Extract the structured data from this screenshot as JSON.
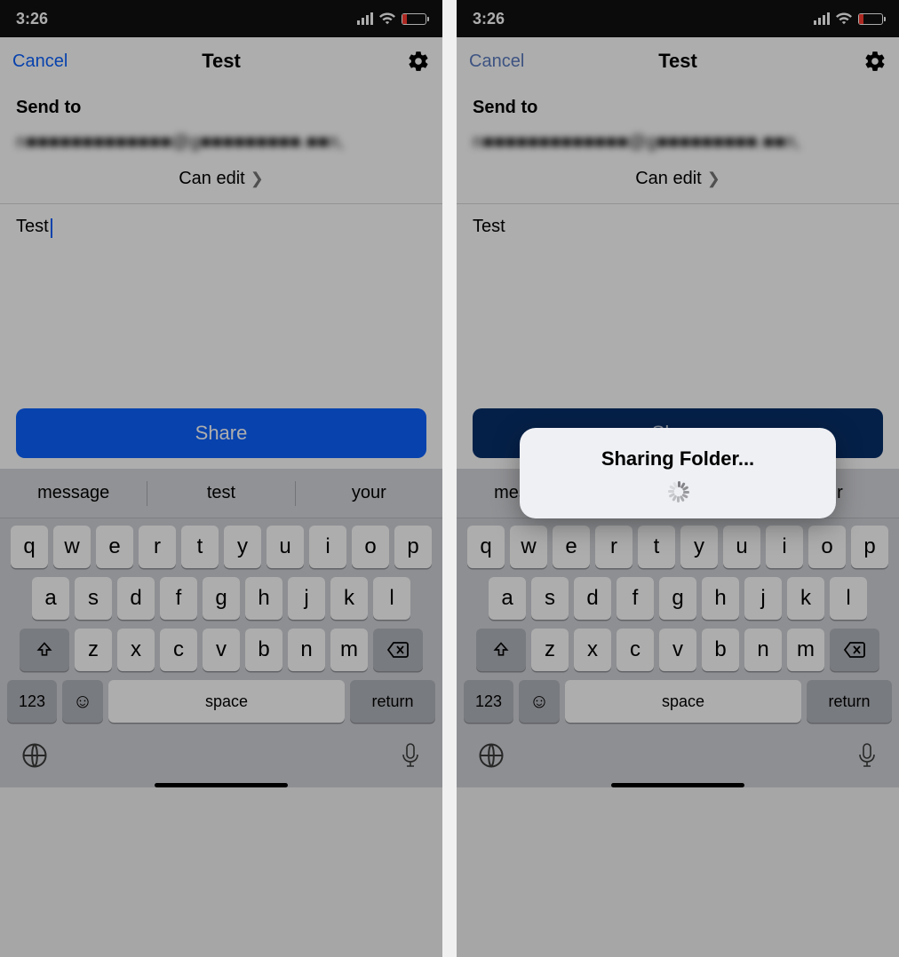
{
  "status": {
    "time": "3:26"
  },
  "nav": {
    "cancel": "Cancel",
    "title": "Test"
  },
  "form": {
    "send_to_label": "Send to",
    "recipient_redacted": "n■■■■■■■■■■■■■@g■■■■■■■■■.■■n",
    "permission_label": "Can edit",
    "message_value": "Test"
  },
  "actions": {
    "share": "Share"
  },
  "keyboard": {
    "suggestions": [
      "message",
      "test",
      "your"
    ],
    "row1": [
      "q",
      "w",
      "e",
      "r",
      "t",
      "y",
      "u",
      "i",
      "o",
      "p"
    ],
    "row2": [
      "a",
      "s",
      "d",
      "f",
      "g",
      "h",
      "j",
      "k",
      "l"
    ],
    "row3": [
      "z",
      "x",
      "c",
      "v",
      "b",
      "n",
      "m"
    ],
    "numbers": "123",
    "space": "space",
    "return": "return"
  },
  "modal": {
    "title": "Sharing Folder..."
  }
}
